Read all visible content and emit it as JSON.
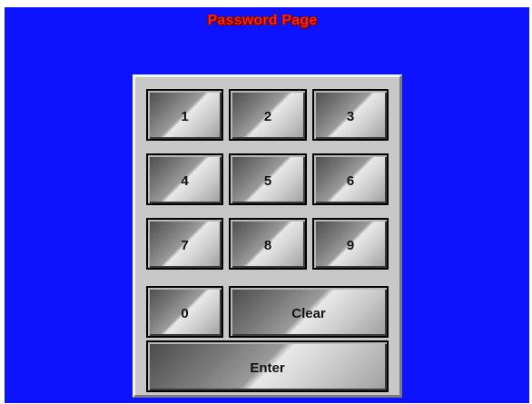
{
  "title": "Password Page",
  "keys": {
    "k1": "1",
    "k2": "2",
    "k3": "3",
    "k4": "4",
    "k5": "5",
    "k6": "6",
    "k7": "7",
    "k8": "8",
    "k9": "9",
    "k0": "0",
    "clear": "Clear",
    "enter": "Enter"
  },
  "colors": {
    "background": "#0b13ff",
    "title": "#ff2020",
    "panel": "#c8c8c8"
  }
}
